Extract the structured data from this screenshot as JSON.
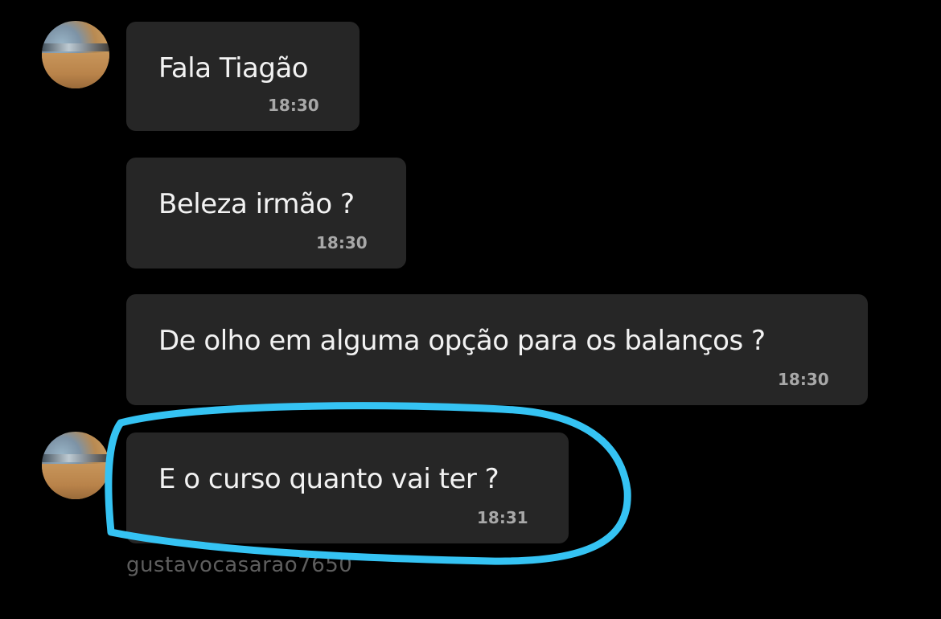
{
  "conversation": {
    "messages": [
      {
        "text": "Fala Tiagão",
        "time": "18:30"
      },
      {
        "text": "Beleza irmão ?",
        "time": "18:30"
      },
      {
        "text": "De olho em alguma opção para os balanços ?",
        "time": "18:30"
      },
      {
        "text": "E o curso quanto vai ter ?",
        "time": "18:31"
      }
    ],
    "sender_username": "gustavocasarao7650"
  },
  "annotation": {
    "highlight_color": "#35c3f3"
  },
  "colors": {
    "background": "#000000",
    "bubble": "#262626",
    "message_text": "#f2f2f2",
    "timestamp": "#a8a8a8",
    "username": "#5e5e5e"
  }
}
